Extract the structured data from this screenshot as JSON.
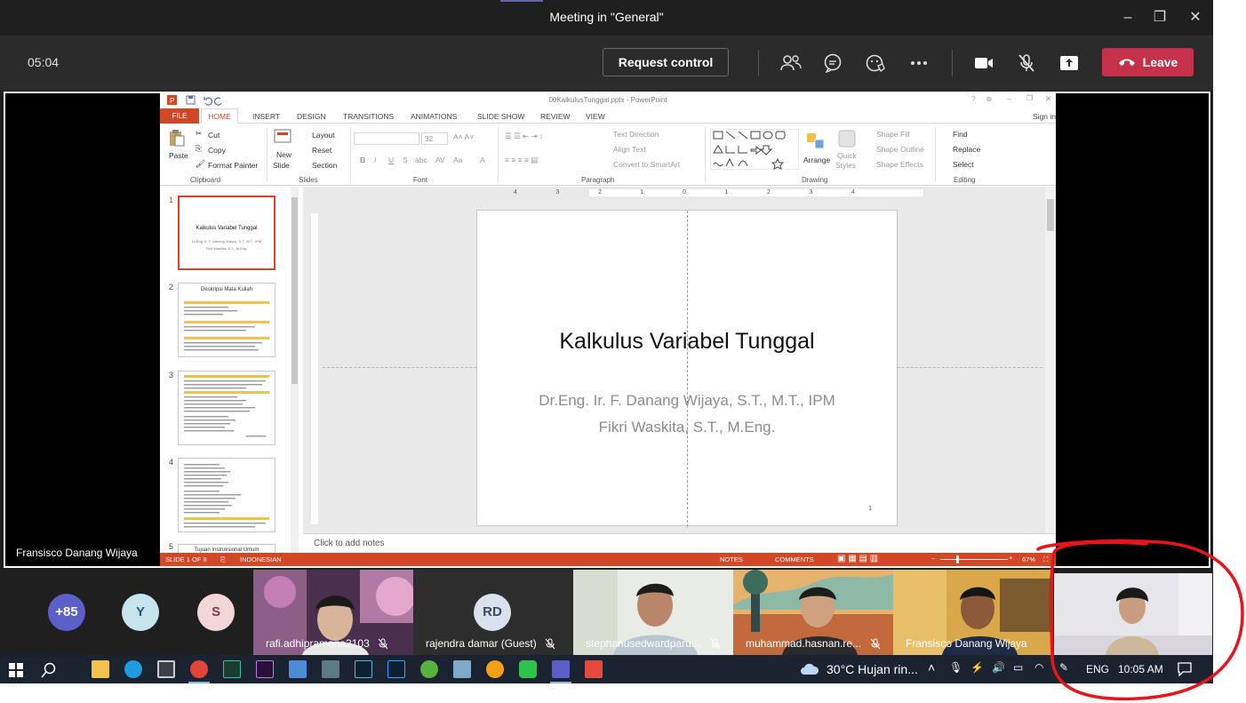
{
  "window": {
    "title": "Meeting in \"General\"",
    "controls": [
      "–",
      "❐",
      "✕"
    ]
  },
  "meeting": {
    "timer": "05:04",
    "request_control_label": "Request control",
    "leave_label": "Leave",
    "presenter_name": "Fransisco Danang Wijaya"
  },
  "powerpoint": {
    "file_title": "00KalkulusTunggal.pptx - PowerPoint",
    "sign_in": "Sign in",
    "tabs": [
      "FILE",
      "HOME",
      "INSERT",
      "DESIGN",
      "TRANSITIONS",
      "ANIMATIONS",
      "SLIDE SHOW",
      "REVIEW",
      "VIEW"
    ],
    "ribbon": {
      "paste": "Paste",
      "cut": "Cut",
      "copy": "Copy",
      "format_painter": "Format Painter",
      "new_slide": "New",
      "new_slide_2": "Slide",
      "layout": "Layout",
      "reset": "Reset",
      "section": "Section",
      "font_size": "32",
      "text_direction": "Text Direction",
      "align_text": "Align Text",
      "convert_smartart": "Convert to SmartArt",
      "arrange": "Arrange",
      "quick_styles": "Quick",
      "quick_styles_2": "Styles",
      "shape_fill": "Shape Fill",
      "shape_outline": "Shape Outline",
      "shape_effects": "Shape Effects",
      "find": "Find",
      "replace": "Replace",
      "select": "Select",
      "groups": [
        "Clipboard",
        "Slides",
        "Font",
        "Paragraph",
        "Drawing",
        "Editing"
      ]
    },
    "thumbnails": [
      {
        "num": "1",
        "title": "Kalkulus Variabel Tunggal",
        "line1": "Dr.Eng. Ir. F. Danang Wijaya, S.T., M.T., IPM",
        "line2": "Fikri Waskita, S.T., M.Eng."
      },
      {
        "num": "2",
        "title": "Deskripsi Mata Kuliah"
      },
      {
        "num": "3"
      },
      {
        "num": "4"
      },
      {
        "num": "5",
        "title": "Tujuan Instruksional Umum"
      }
    ],
    "slide": {
      "title": "Kalkulus Variabel Tunggal",
      "author1": "Dr.Eng. Ir. F. Danang Wijaya, S.T., M.T., IPM",
      "author2": "Fikri Waskita, S.T., M.Eng.",
      "number": "1"
    },
    "ruler_labels": [
      "4",
      "3",
      "2",
      "1",
      "0",
      "1",
      "2",
      "3",
      "4"
    ],
    "notes_placeholder": "Click to add notes",
    "status": {
      "slide_of": "SLIDE 1 OF 8",
      "language": "INDONESIAN",
      "notes": "NOTES",
      "comments": "COMMENTS",
      "zoom": "67%"
    }
  },
  "participants": {
    "overflow": {
      "label": "+85",
      "color": "#5b5fc7"
    },
    "avatars": [
      {
        "initial": "Y",
        "bg": "#c7e4ec",
        "fg": "#2b5b6b"
      },
      {
        "initial": "S",
        "bg": "#f3d6d8",
        "fg": "#8a3a44"
      }
    ],
    "tiles": [
      {
        "name": "rafi.adhipramana2103"
      },
      {
        "name": "rajendra damar (Guest)",
        "initials": "RD"
      },
      {
        "name": "stephanusedwardparu..."
      },
      {
        "name": "muhammad.hasnan.re..."
      },
      {
        "name": "Fransisco Danang Wijaya"
      }
    ]
  },
  "taskbar": {
    "weather": "30°C  Hujan rin...",
    "language": "ENG",
    "time": "10:05 AM"
  },
  "colors": {
    "teams_dark": "#1f1f1f",
    "leave_red": "#c4314b",
    "ppt_orange": "#d24726",
    "annotation_red": "#e8141a"
  }
}
